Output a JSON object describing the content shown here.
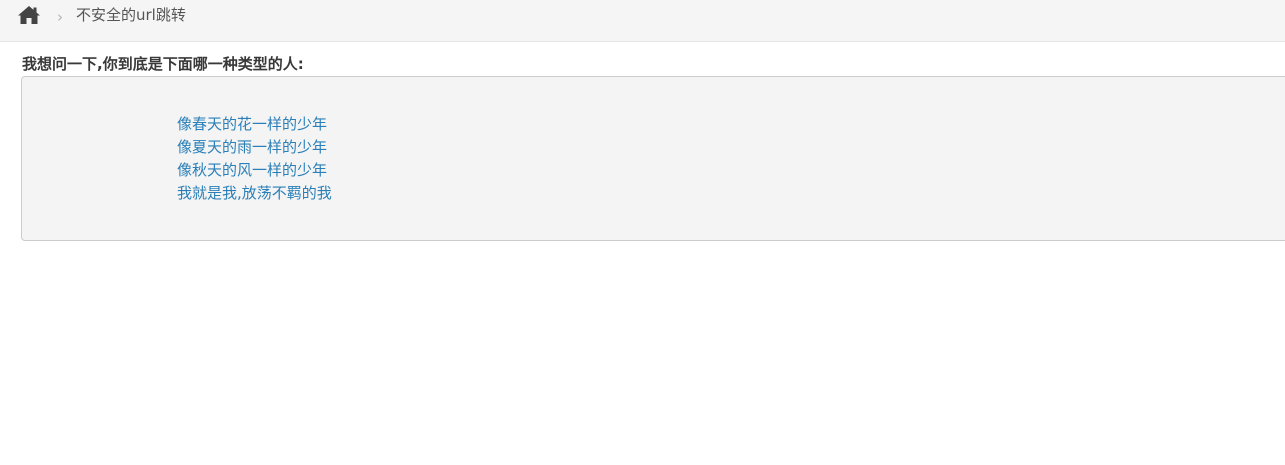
{
  "breadcrumb": {
    "home_icon": "home-icon",
    "separator": "›",
    "current": "不安全的url跳转"
  },
  "main": {
    "question": "我想问一下,你到底是下面哪一种类型的人:",
    "options": [
      "像春天的花一样的少年",
      "像夏天的雨一样的少年",
      "像秋天的风一样的少年",
      "我就是我,放荡不羁的我"
    ]
  },
  "colors": {
    "link": "#2a7fb8",
    "breadcrumb_bg": "#f5f5f5",
    "panel_bg": "#f4f4f4"
  }
}
